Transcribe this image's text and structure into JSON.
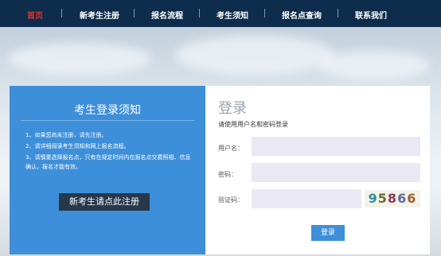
{
  "nav": {
    "items": [
      {
        "label": "首页",
        "active": true
      },
      {
        "label": "新考生注册",
        "active": false
      },
      {
        "label": "报名流程",
        "active": false
      },
      {
        "label": "考生须知",
        "active": false
      },
      {
        "label": "报名点查询",
        "active": false
      },
      {
        "label": "联系我们",
        "active": false
      }
    ]
  },
  "notice": {
    "title": "考生登录须知",
    "items": [
      "1、如果您尚未注册，请先注册。",
      "2、请详细阅读考生须知和网上报名流程。",
      "3、请慎重选择报名点，只有在规定时间内在报名点交费照相、信息确认，报名才能有效。"
    ],
    "register_button": "新考生请点此注册"
  },
  "login": {
    "title": "登录",
    "subtitle": "请使用用户名和密码登录",
    "username_label": "用户名：",
    "password_label": "密码：",
    "captcha_label": "验证码：",
    "captcha_text": [
      "9",
      "5",
      "8",
      "6",
      "6"
    ],
    "submit": "登录"
  },
  "colors": {
    "nav_bg": "#0e2d4c",
    "nav_active": "#e0322e",
    "panel_blue": "#3e8fd9",
    "button_dark": "#26384a",
    "input_bg": "#e9e8f3"
  }
}
